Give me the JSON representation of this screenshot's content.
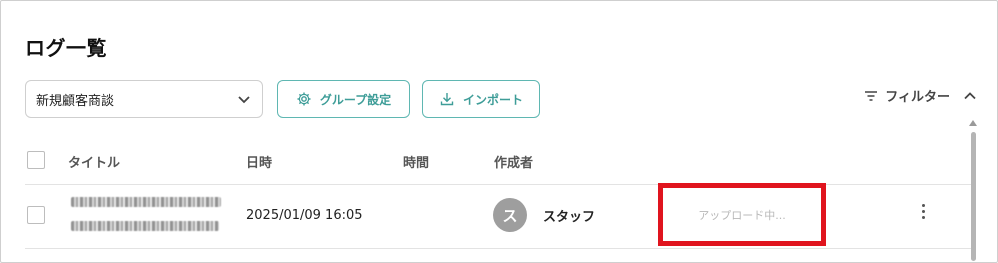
{
  "page": {
    "title": "ログ一覧"
  },
  "toolbar": {
    "group_select": {
      "value": "新規顧客商談",
      "icon": "chevron-down-icon"
    },
    "group_settings_label": "グループ設定",
    "group_settings_icon": "gear-icon",
    "import_label": "インポート",
    "import_icon": "download-icon",
    "filter_label": "フィルター",
    "filter_icon": "filter-lines-icon",
    "filter_toggle_icon": "chevron-up-icon"
  },
  "table": {
    "columns": [
      "タイトル",
      "日時",
      "時間",
      "作成者"
    ],
    "rows": [
      {
        "datetime": "2025/01/09 16:05",
        "duration": "",
        "author": {
          "avatar_initial": "ス",
          "name": "スタッフ"
        },
        "status": "アップロード中...",
        "menu_icon": "kebab-menu-icon"
      }
    ]
  },
  "colors": {
    "accent": "#3e9d98",
    "highlight_border": "#e0141e",
    "avatar_bg": "#9e9e9e"
  }
}
